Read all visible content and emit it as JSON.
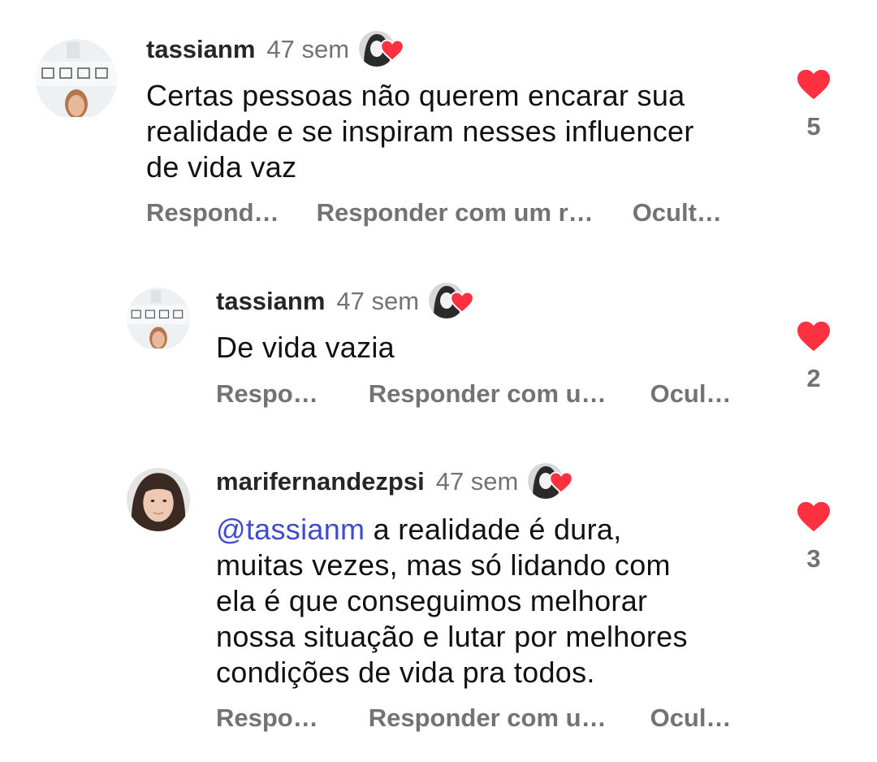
{
  "comments": [
    {
      "username": "tassianm",
      "time": "47 sem",
      "text": "Certas pessoas não querem encarar sua realidade e se inspiram nesses influencer de vida vaz",
      "text_lines": [
        "Certas pessoas não querem encarar sua",
        "realidade e se inspiram nesses influencer",
        "de vida vaz"
      ],
      "actions": [
        "Respond…",
        "Responder com um r…",
        "Ocult…"
      ],
      "likes": "5"
    },
    {
      "username": "tassianm",
      "time": "47 sem",
      "text_lines": [
        "De vida vazia"
      ],
      "actions": [
        "Respo…",
        "Responder com u…",
        "Ocul…"
      ],
      "likes": "2"
    },
    {
      "username": "marifernandezpsi",
      "time": "47 sem",
      "mention": "@tassianm",
      "text_lines": [
        " a realidade é dura,",
        "muitas vezes, mas só lidando com",
        "ela é que conseguimos melhorar",
        "nossa situação e lutar por melhores",
        "condições de vida pra todos."
      ],
      "actions": [
        "Respo…",
        "Responder com u…",
        "Ocul…"
      ],
      "likes": "3"
    }
  ],
  "colors": {
    "heart": "#ff3040",
    "mention": "#3f4bd1",
    "muted": "#737373"
  },
  "icons": {
    "like": "heart-icon",
    "creator_liked": "creator-like-badge"
  }
}
